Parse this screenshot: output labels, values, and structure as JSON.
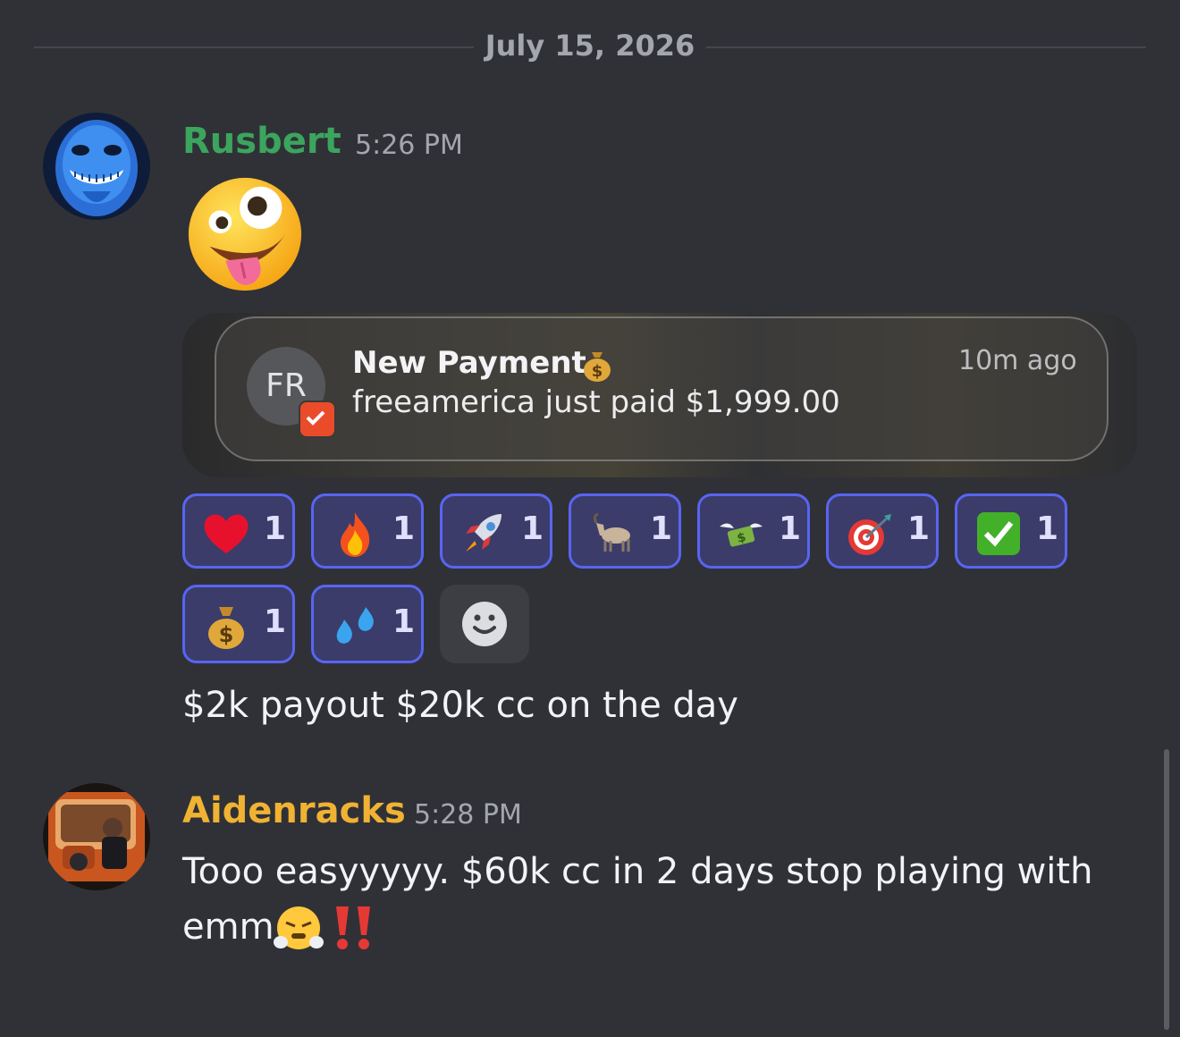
{
  "date_divider": "July 15, 2026",
  "colors": {
    "background": "#303137",
    "rusbert_name": "#3ba55d",
    "aidenracks_name": "#f0b232",
    "reaction_border": "#5865f2",
    "reaction_fill": "#3b3c6a"
  },
  "messages": [
    {
      "author": "Rusbert",
      "time": "5:26 PM",
      "avatar_icon": "blue-skull-avatar",
      "big_emoji": "zany-face-emoji",
      "notification": {
        "avatar_text": "FR",
        "title": "New Payment",
        "title_icon": "money-bag-emoji",
        "body": "freeamerica just paid $1,999.00",
        "time": "10m ago"
      },
      "reactions": [
        {
          "emoji": "red-heart",
          "count": "1"
        },
        {
          "emoji": "fire",
          "count": "1"
        },
        {
          "emoji": "rocket",
          "count": "1"
        },
        {
          "emoji": "goat",
          "count": "1"
        },
        {
          "emoji": "money-with-wings",
          "count": "1"
        },
        {
          "emoji": "direct-hit",
          "count": "1"
        },
        {
          "emoji": "check-mark-button",
          "count": "1"
        },
        {
          "emoji": "money-bag",
          "count": "1"
        },
        {
          "emoji": "sweat-droplets",
          "count": "1"
        }
      ],
      "text": "$2k payout $20k cc on the day"
    },
    {
      "author": "Aidenracks",
      "time": "5:28 PM",
      "avatar_icon": "car-interior-photo-avatar",
      "text_line1": "Tooo easyyyyy. $60k cc in 2 days stop playing with",
      "text_line2": "emm",
      "trailing_emojis": [
        "face-with-steam-emoji",
        "double-exclamation-emoji"
      ]
    }
  ]
}
